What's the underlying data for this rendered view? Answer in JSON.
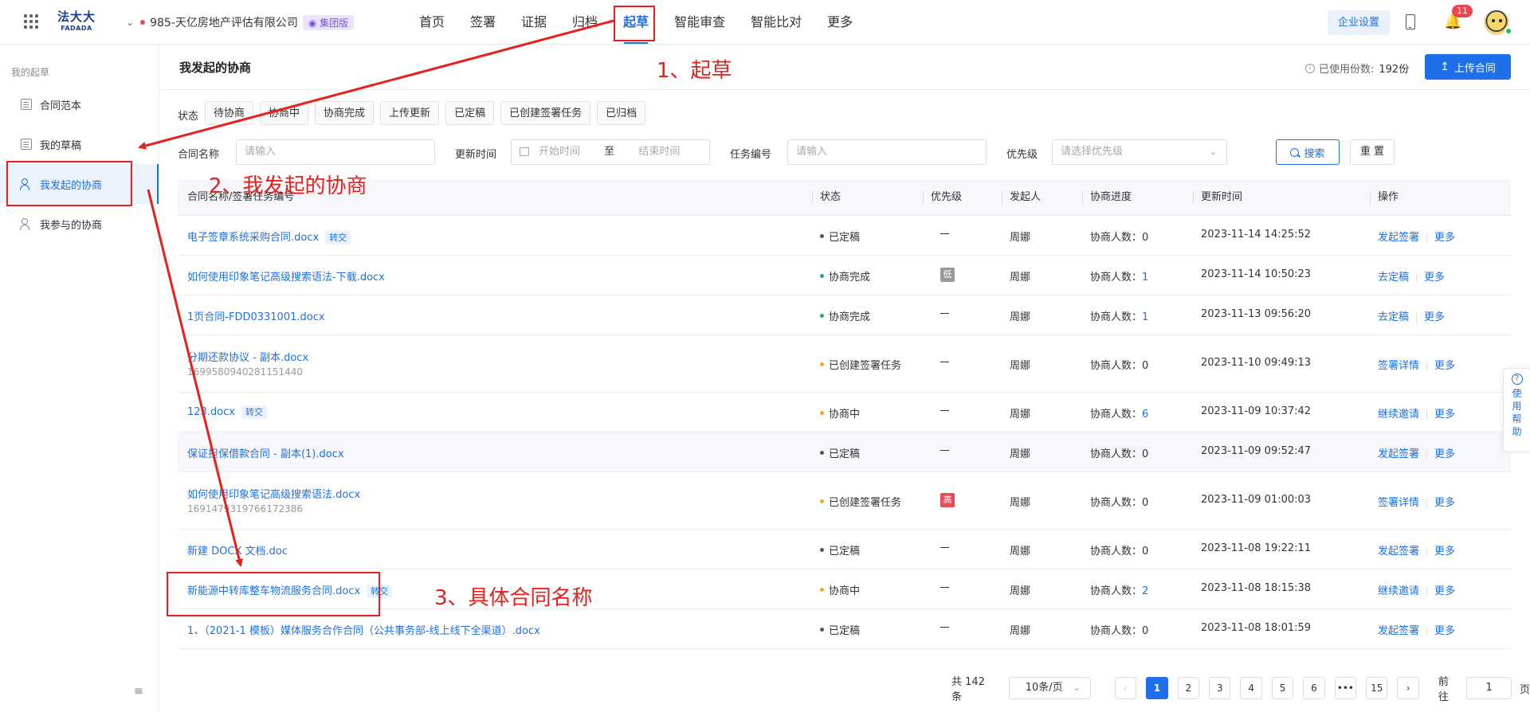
{
  "header": {
    "logo_cn": "法大大",
    "logo_en": "FADADA",
    "company": "985-天亿房地产评估有限公司",
    "company_badge": "集团版",
    "nav": [
      "首页",
      "签署",
      "证据",
      "归档",
      "起草",
      "智能审查",
      "智能比对",
      "更多"
    ],
    "active_nav": "起草",
    "enterprise_settings": "企业设置",
    "notification_count": "11"
  },
  "sidebar": {
    "title": "我的起草",
    "items": [
      {
        "label": "合同范本",
        "icon": "document-icon"
      },
      {
        "label": "我的草稿",
        "icon": "document-icon"
      },
      {
        "label": "我发起的协商",
        "icon": "people-icon"
      },
      {
        "label": "我参与的协商",
        "icon": "person-icon"
      }
    ],
    "active": "我发起的协商"
  },
  "page": {
    "title": "我发起的协商",
    "usage_label": "已使用份数:",
    "usage_count": "192份",
    "upload_button": "上传合同"
  },
  "filters": {
    "status_label": "状态",
    "status_chips": [
      "待协商",
      "协商中",
      "协商完成",
      "上传更新",
      "已定稿",
      "已创建签署任务",
      "已归档"
    ],
    "name_label": "合同名称",
    "name_placeholder": "请输入",
    "update_time_label": "更新时间",
    "start_placeholder": "开始时间",
    "range_sep": "至",
    "end_placeholder": "结束时间",
    "task_no_label": "任务编号",
    "task_no_placeholder": "请输入",
    "priority_label": "优先级",
    "priority_placeholder": "请选择优先级",
    "search_button": "搜索",
    "reset_button": "重 置"
  },
  "table": {
    "columns": [
      "合同名称/签署任务编号",
      "状态",
      "优先级",
      "发起人",
      "协商进度",
      "更新时间",
      "操作"
    ],
    "progress_prefix": "协商人数：",
    "rows": [
      {
        "name": "电子签章系统采购合同.docx",
        "tag": "转交",
        "sub": "",
        "status": "已定稿",
        "status_color": "#555555",
        "priority": "-",
        "initiator": "周娜",
        "progress": "0",
        "updated": "2023-11-14 14:25:52",
        "op1": "发起签署",
        "op2": "更多"
      },
      {
        "name": "如何使用印象笔记高级搜索语法-下载.docx",
        "tag": "",
        "sub": "",
        "status": "协商完成",
        "status_color": "#2ba471",
        "priority": "低",
        "initiator": "周娜",
        "progress": "1",
        "updated": "2023-11-14 10:50:23",
        "op1": "去定稿",
        "op2": "更多"
      },
      {
        "name": "1页合同-FDD0331001.docx",
        "tag": "",
        "sub": "",
        "status": "协商完成",
        "status_color": "#2ba471",
        "priority": "-",
        "initiator": "周娜",
        "progress": "1",
        "updated": "2023-11-13 09:56:20",
        "op1": "去定稿",
        "op2": "更多"
      },
      {
        "name": "分期还款协议 - 副本.docx",
        "tag": "",
        "sub": "1699580940281151440",
        "status": "已创建签署任务",
        "status_color": "#f5a623",
        "priority": "-",
        "initiator": "周娜",
        "progress": "0",
        "updated": "2023-11-10 09:49:13",
        "op1": "签署详情",
        "op2": "更多"
      },
      {
        "name": "123.docx",
        "tag": "转交",
        "sub": "",
        "status": "协商中",
        "status_color": "#f5a623",
        "priority": "-",
        "initiator": "周娜",
        "progress": "6",
        "updated": "2023-11-09 10:37:42",
        "op1": "继续邀请",
        "op2": "更多"
      },
      {
        "name": "保证担保借款合同 - 副本(1).docx",
        "tag": "",
        "sub": "",
        "status": "已定稿",
        "status_color": "#555555",
        "priority": "-",
        "initiator": "周娜",
        "progress": "0",
        "updated": "2023-11-09 09:52:47",
        "op1": "发起签署",
        "op2": "更多"
      },
      {
        "name": "如何使用印象笔记高级搜索语法.docx",
        "tag": "",
        "sub": "1691479319766172386",
        "status": "已创建签署任务",
        "status_color": "#f5a623",
        "priority": "高",
        "initiator": "周娜",
        "progress": "0",
        "updated": "2023-11-09 01:00:03",
        "op1": "签署详情",
        "op2": "更多"
      },
      {
        "name": "新建 DOCX 文档.doc",
        "tag": "",
        "sub": "",
        "status": "已定稿",
        "status_color": "#555555",
        "priority": "-",
        "initiator": "周娜",
        "progress": "0",
        "updated": "2023-11-08 19:22:11",
        "op1": "发起签署",
        "op2": "更多"
      },
      {
        "name": "新能源中转库整车物流服务合同.docx",
        "tag": "转交",
        "sub": "",
        "status": "协商中",
        "status_color": "#f5a623",
        "priority": "-",
        "initiator": "周娜",
        "progress": "2",
        "updated": "2023-11-08 18:15:38",
        "op1": "继续邀请",
        "op2": "更多"
      },
      {
        "name": "1、（2021-1 模板）媒体服务合作合同（公共事务部-线上线下全渠道）.docx",
        "tag": "",
        "sub": "",
        "status": "已定稿",
        "status_color": "#555555",
        "priority": "-",
        "initiator": "周娜",
        "progress": "0",
        "updated": "2023-11-08 18:01:59",
        "op1": "发起签署",
        "op2": "更多"
      }
    ]
  },
  "pagination": {
    "total": "共 142 条",
    "page_size": "10条/页",
    "pages": [
      "1",
      "2",
      "3",
      "4",
      "5",
      "6",
      "•••",
      "15"
    ],
    "current": "1",
    "goto_label": "前往",
    "goto_value": "1",
    "page_suffix": "页"
  },
  "help_widget": "使用帮助",
  "annotations": {
    "a1": "1、起草",
    "a2": "2、我发起的协商",
    "a3": "3、具体合同名称",
    "color": "#e8201b"
  },
  "colors": {
    "accent": "#1e6fe8",
    "annotation": "#e8201b"
  }
}
